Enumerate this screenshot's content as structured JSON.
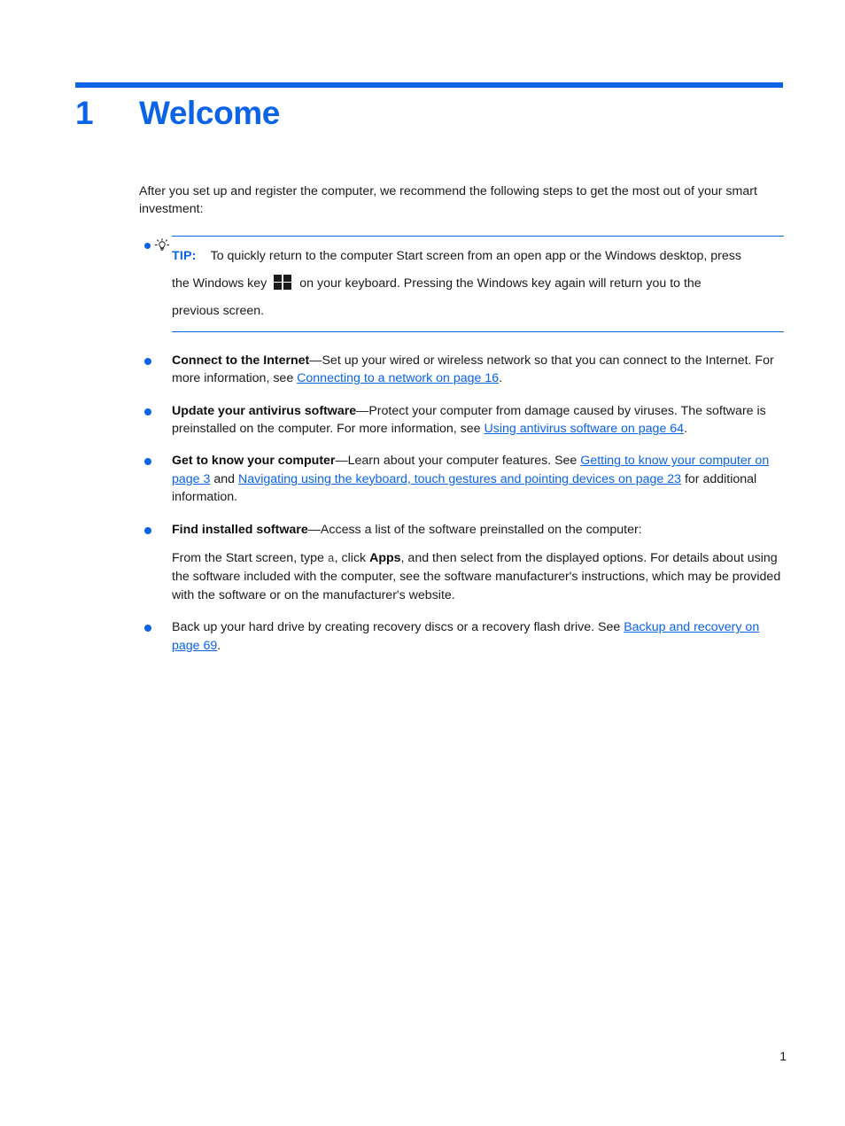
{
  "document": {
    "chapter_number": "1",
    "chapter_title": "Welcome",
    "page_number": "1",
    "accent_color": "#0b63e8",
    "text_color": "#1a1a1a"
  },
  "intro": {
    "text": "After you set up and register the computer, we recommend the following steps to get the most out of your smart investment:"
  },
  "note": {
    "icon": "lightbulb-icon",
    "label": "TIP:",
    "line1": "To quickly return to the computer Start screen from an open app or the Windows desktop, press",
    "line2_before_key": "the Windows key",
    "key_icon": "windows-logo-icon",
    "line2_after_key": "on your keyboard. Pressing the Windows key again will return you to the",
    "line3": "previous screen."
  },
  "bullets": [
    {
      "lead": "Connect to the Internet",
      "text_after_lead": "—Set up your wired or wireless network so that you can connect to the Internet. For more information, see ",
      "link": "Connecting to a network on page 16",
      "text_tail": "."
    },
    {
      "lead": "Update your antivirus software",
      "text_after_lead": "—Protect your computer from damage caused by viruses. The software is preinstalled on the computer. For more information, see ",
      "link": "Using antivirus software on page 64",
      "text_tail": "."
    },
    {
      "lead": "Get to know your computer",
      "text_after_lead": "—Learn about your computer features. See ",
      "link": "Getting to know your computer on page 3",
      "text_middle": " and ",
      "link2": "Navigating using the keyboard, touch gestures and pointing devices on page 23",
      "text_tail": " for additional information."
    },
    {
      "lead": "Find installed software",
      "text_after_lead": "—Access a list of the software preinstalled on the computer:",
      "sub_paragraph": {
        "part1": "From the Start screen, type ",
        "code": "a",
        "part2": ", click ",
        "bold": "Apps",
        "part3": ", and then select from the displayed options. For details about using the software included with the computer, see the software manufacturer's instructions, which may be provided with the software or on the manufacturer's website."
      }
    },
    {
      "text_plain": "Back up your hard drive by creating recovery discs or a recovery flash drive. See ",
      "link": "Backup and recovery on page 69",
      "text_tail": "."
    }
  ]
}
